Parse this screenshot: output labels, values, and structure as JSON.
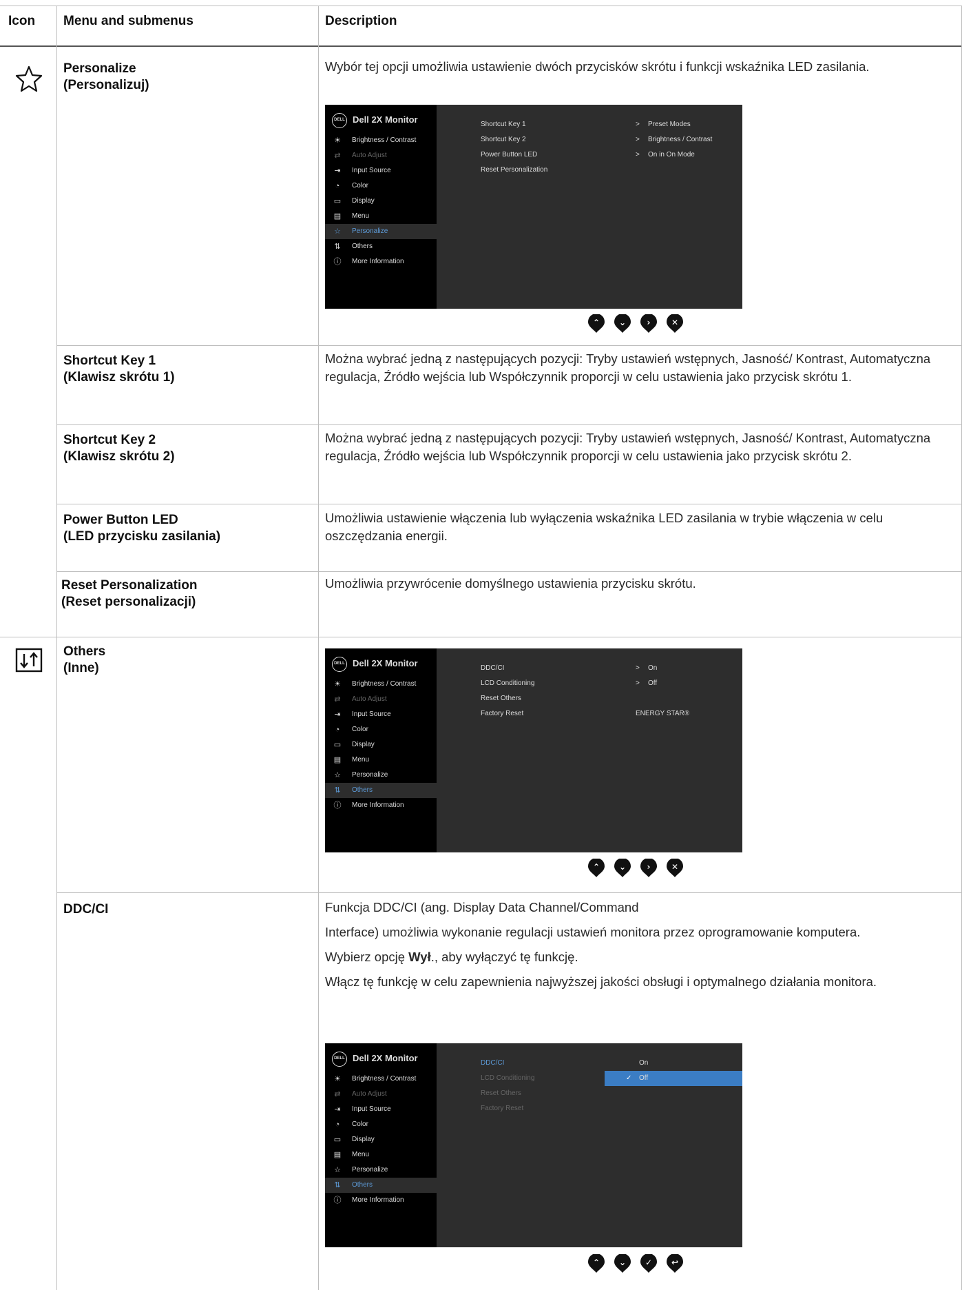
{
  "header": {
    "icon": "Icon",
    "menu": "Menu and submenus",
    "desc": "Description"
  },
  "personalize": {
    "icon": "star-icon",
    "name": "Personalize\n(Personalizuj)",
    "desc": "Wybór tej opcji umożliwia ustawienie dwóch przycisków skrótu i funkcji wskaźnika LED zasilania."
  },
  "shortcut1": {
    "name": "Shortcut Key 1\n(Klawisz skrótu 1)",
    "desc": "Można wybrać jedną z następujących pozycji: Tryby ustawień wstępnych, Jasność/ Kontrast, Automatyczna regulacja, Źródło wejścia lub Współczynnik proporcji w celu ustawienia jako przycisk skrótu 1."
  },
  "shortcut2": {
    "name": "Shortcut Key 2\n(Klawisz skrótu 2)",
    "desc": "Można wybrać jedną z następujących pozycji: Tryby ustawień wstępnych, Jasność/ Kontrast, Automatyczna regulacja, Źródło wejścia lub Współczynnik proporcji w celu ustawienia jako przycisk skrótu 2."
  },
  "powerled": {
    "name": "Power Button LED\n(LED przycisku zasilania)",
    "desc": "Umożliwia ustawienie włączenia lub wyłączenia wskaźnika LED zasilania w trybie włączenia w celu oszczędzania energii."
  },
  "resetpers": {
    "name": "Reset Personalization\n(Reset personalizacji)",
    "desc": "Umożliwia przywrócenie domyślnego ustawienia przycisku skrótu."
  },
  "others": {
    "icon": "others-icon",
    "name": "Others\n(Inne)"
  },
  "ddcci": {
    "name": "DDC/CI",
    "p1": "Funkcja DDC/CI (ang. Display Data Channel/Command",
    "p2": "Interface) umożliwia wykonanie regulacji ustawień monitora przez oprogramowanie komputera.",
    "p3_pre": "Wybierz opcję ",
    "p3_bold": "Wył",
    "p3_post": "., aby wyłączyć tę funkcję.",
    "p4": "Włącz tę funkcję w celu zapewnienia najwyższej jakości obsługi i optymalnego działania monitora."
  },
  "osd_common": {
    "logo": "DELL",
    "title": "Dell 2X Monitor",
    "menu": [
      {
        "icon": "brightness-icon",
        "glyph": "☀",
        "label": "Brightness / Contrast"
      },
      {
        "icon": "auto-adjust-icon",
        "glyph": "⇄",
        "label": "Auto Adjust"
      },
      {
        "icon": "input-source-icon",
        "glyph": "⇥",
        "label": "Input Source"
      },
      {
        "icon": "color-icon",
        "glyph": "◔",
        "label": "Color"
      },
      {
        "icon": "display-icon",
        "glyph": "▭",
        "label": "Display"
      },
      {
        "icon": "menu-icon",
        "glyph": "▤",
        "label": "Menu"
      },
      {
        "icon": "personalize-icon",
        "glyph": "☆",
        "label": "Personalize"
      },
      {
        "icon": "others-icon",
        "glyph": "⇅",
        "label": "Others"
      },
      {
        "icon": "info-icon",
        "glyph": "ⓘ",
        "label": "More Information"
      }
    ]
  },
  "osd1": {
    "selected": 6,
    "subs": [
      "Shortcut Key 1",
      "Shortcut Key 2",
      "Power Button LED",
      "Reset Personalization"
    ],
    "vals": [
      "Preset Modes",
      "Brightness / Contrast",
      "On in On Mode"
    ],
    "buttons": [
      "up-button",
      "down-button",
      "right-button",
      "close-button"
    ],
    "glyphs": [
      "⌃",
      "⌄",
      "›",
      "✕"
    ]
  },
  "osd2": {
    "selected": 7,
    "subs": [
      "DDC/CI",
      "LCD Conditioning",
      "Reset Others",
      "Factory Reset"
    ],
    "vals": [
      "On",
      "Off"
    ],
    "energy": "ENERGY STAR®",
    "buttons": [
      "up-button",
      "down-button",
      "right-button",
      "close-button"
    ],
    "glyphs": [
      "⌃",
      "⌄",
      "›",
      "✕"
    ]
  },
  "osd3": {
    "selected": 7,
    "subs": [
      "DDC/CI",
      "LCD Conditioning",
      "Reset Others",
      "Factory Reset"
    ],
    "opts": [
      "On",
      "Off"
    ],
    "checked": "✓",
    "buttons": [
      "up-button",
      "down-button",
      "check-button",
      "back-button"
    ],
    "glyphs": [
      "⌃",
      "⌄",
      "✓",
      "↩"
    ]
  }
}
